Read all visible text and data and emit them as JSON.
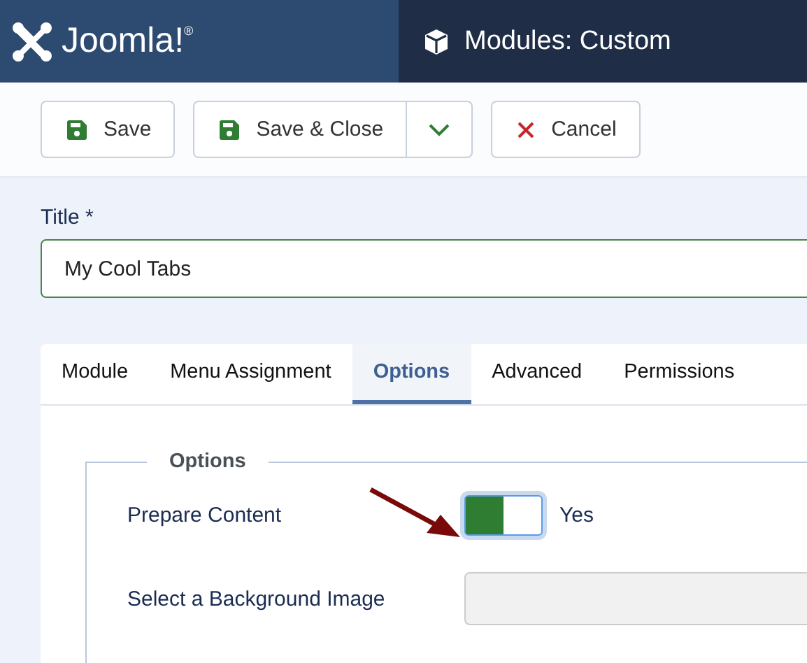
{
  "header": {
    "logo_text": "Joomla!$^{®}$",
    "title": "Modules: Custom"
  },
  "toolbar": {
    "buttons": [
      {
        "label": "Save",
        "kind": "save",
        "dropdown": false
      },
      {
        "label": "Save & Close",
        "kind": "save",
        "dropdown": true
      },
      {
        "label": "Cancel",
        "kind": "cancel",
        "dropdown": false
      }
    ]
  },
  "title_field": {
    "label": "Title *",
    "value": "My Cool Tabs"
  },
  "tabs": [
    {
      "label": "Module",
      "selected": false
    },
    {
      "label": "Menu Assignment",
      "selected": false
    },
    {
      "label": "Options",
      "selected": true
    },
    {
      "label": "Advanced",
      "selected": false
    },
    {
      "label": "Permissions",
      "selected": false
    }
  ],
  "fieldset": {
    "legend": "Options",
    "fields": [
      {
        "label": "Prepare Content",
        "kind": "switch",
        "on": true,
        "value_label": "Yes"
      },
      {
        "label": "Select a Background Image",
        "kind": "media"
      }
    ]
  }
}
